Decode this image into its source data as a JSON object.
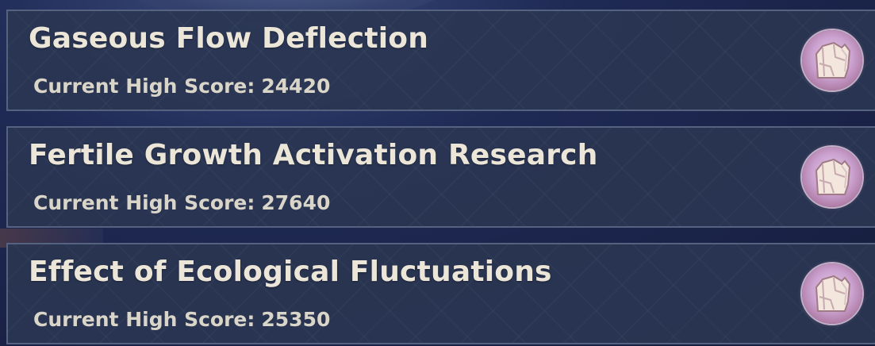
{
  "score_label": "Current High Score:",
  "challenges": [
    {
      "title": "Gaseous Flow Deflection",
      "high_score": "24420",
      "badge_icon": "stone-monument-icon"
    },
    {
      "title": "Fertile Growth Activation Research",
      "high_score": "27640",
      "badge_icon": "stone-monument-icon"
    },
    {
      "title": "Effect of Ecological Fluctuations",
      "high_score": "25350",
      "badge_icon": "stone-monument-icon"
    }
  ],
  "colors": {
    "card_background": "#2a3652",
    "title_text": "#ece6d8",
    "score_text": "#dad5c9",
    "badge": "#cba2d0"
  }
}
